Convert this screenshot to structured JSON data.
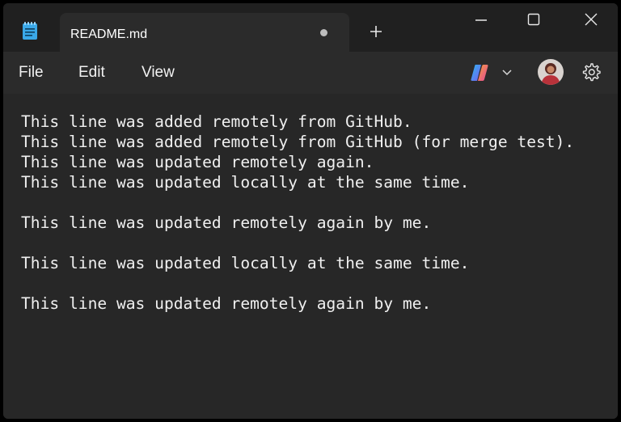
{
  "tab": {
    "title": "README.md"
  },
  "menu": {
    "file": "File",
    "edit": "Edit",
    "view": "View"
  },
  "editor": {
    "content": "This line was added remotely from GitHub.\nThis line was added remotely from GitHub (for merge test).\nThis line was updated remotely again.\nThis line was updated locally at the same time.\n\nThis line was updated remotely again by me.\n\nThis line was updated locally at the same time.\n\nThis line was updated remotely again by me."
  },
  "icons": {
    "app": "notepad-icon",
    "new_tab": "plus-icon",
    "minimize": "minimize-icon",
    "maximize": "maximize-icon",
    "close": "close-icon",
    "copilot": "copilot-icon",
    "dropdown": "chevron-down-icon",
    "settings": "gear-icon"
  },
  "colors": {
    "window_bg": "#202020",
    "tab_bg": "#2b2b2b",
    "editor_bg": "#272727",
    "text": "#f0f0f0",
    "accent": "#4cc2ff"
  }
}
